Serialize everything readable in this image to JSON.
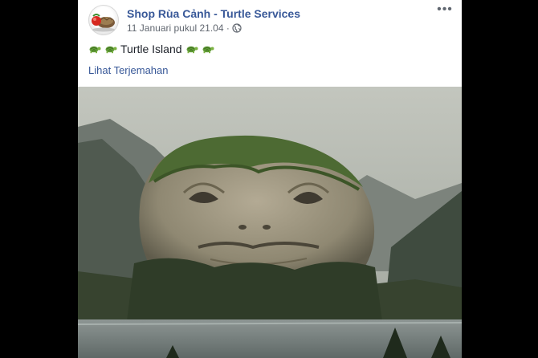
{
  "post": {
    "page_name": "Shop Rùa Cảnh - Turtle Services",
    "timestamp": "11 Januari pukul 21.04 ·",
    "more_label": "•••",
    "caption_text": "Turtle Island",
    "see_translation": "Lihat Terjemahan",
    "avatar_icon": "turtle-avatar-icon",
    "privacy_icon": "globe-icon",
    "caption_emoji": "turtle-icon",
    "colors": {
      "link": "#385898",
      "meta": "#616770",
      "text": "#1d2129"
    }
  }
}
